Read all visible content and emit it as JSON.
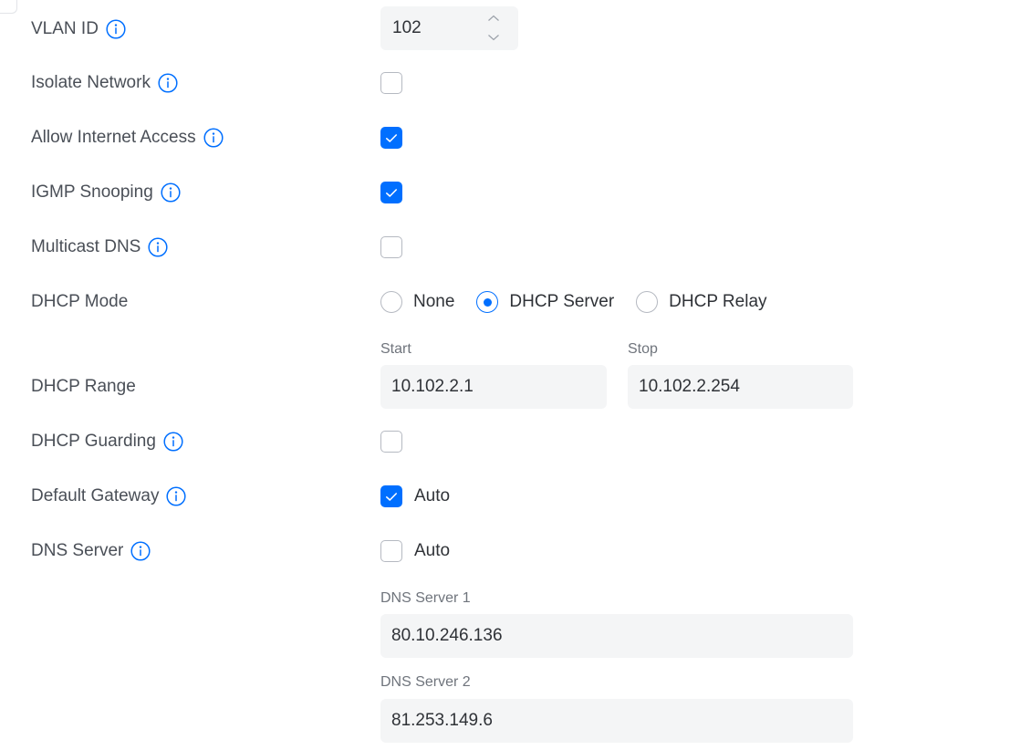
{
  "vlan": {
    "label": "VLAN ID",
    "value": "102"
  },
  "isolate_network": {
    "label": "Isolate Network",
    "checked": false
  },
  "allow_internet_access": {
    "label": "Allow Internet Access",
    "checked": true
  },
  "igmp_snooping": {
    "label": "IGMP Snooping",
    "checked": true
  },
  "multicast_dns": {
    "label": "Multicast DNS",
    "checked": false
  },
  "dhcp_mode": {
    "label": "DHCP Mode",
    "options": [
      "None",
      "DHCP Server",
      "DHCP Relay"
    ],
    "selected": "DHCP Server"
  },
  "dhcp_range": {
    "label": "DHCP Range",
    "start_caption": "Start",
    "start_value": "10.102.2.1",
    "stop_caption": "Stop",
    "stop_value": "10.102.2.254"
  },
  "dhcp_guarding": {
    "label": "DHCP Guarding",
    "checked": false
  },
  "default_gateway": {
    "label": "Default Gateway",
    "auto_label": "Auto",
    "auto_checked": true
  },
  "dns_server": {
    "label": "DNS Server",
    "auto_label": "Auto",
    "auto_checked": false,
    "server1_caption": "DNS Server 1",
    "server1_value": "80.10.246.136",
    "server2_caption": "DNS Server 2",
    "server2_value": "81.253.149.6"
  },
  "colors": {
    "accent": "#006fff",
    "field_background": "#f4f5f6",
    "label_text": "#4a4f57",
    "caption_text": "#6f747c"
  },
  "icons": {
    "info": "info-circle-icon",
    "checkmark": "checkmark-icon",
    "stepper_up": "chevron-up-icon",
    "stepper_down": "chevron-down-icon"
  }
}
